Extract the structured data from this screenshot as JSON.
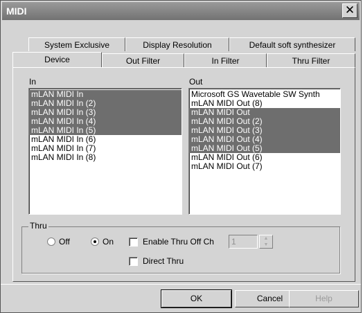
{
  "window": {
    "title": "MIDI",
    "close_glyph": "✕"
  },
  "tabs": {
    "back_row": [
      "System Exclusive",
      "Display Resolution",
      "Default soft synthesizer"
    ],
    "front_row": [
      "Device",
      "Out Filter",
      "In Filter",
      "Thru Filter"
    ],
    "active": "Device"
  },
  "in_list": {
    "label": "In",
    "items": [
      "mLAN MIDI In",
      "mLAN MIDI In (2)",
      "mLAN MIDI In (3)",
      "mLAN MIDI In (4)",
      "mLAN MIDI In (5)",
      "mLAN MIDI In (6)",
      "mLAN MIDI In (7)",
      "mLAN MIDI In (8)"
    ],
    "selected": [
      0,
      1,
      2,
      3,
      4
    ]
  },
  "out_list": {
    "label": "Out",
    "items": [
      "Microsoft GS Wavetable SW Synth",
      "mLAN MIDI Out (8)",
      "mLAN MIDI Out",
      "mLAN MIDI Out (2)",
      "mLAN MIDI Out (3)",
      "mLAN MIDI Out (4)",
      "mLAN MIDI Out (5)",
      "mLAN MIDI Out (6)",
      "mLAN MIDI Out (7)"
    ],
    "selected": [
      2,
      3,
      4,
      5,
      6
    ]
  },
  "thru": {
    "label": "Thru",
    "off_label": "Off",
    "on_label": "On",
    "selected": "On",
    "enable_thru_off_ch_label": "Enable Thru Off Ch",
    "enable_thru_off_ch_checked": false,
    "channel_value": "1",
    "direct_thru_label": "Direct Thru",
    "direct_thru_checked": false
  },
  "buttons": {
    "ok": "OK",
    "cancel": "Cancel",
    "help": "Help"
  },
  "colors": {
    "selection": "#6e6e6e",
    "titlebar": "#7f7f7f",
    "face": "#d4d4d4"
  }
}
